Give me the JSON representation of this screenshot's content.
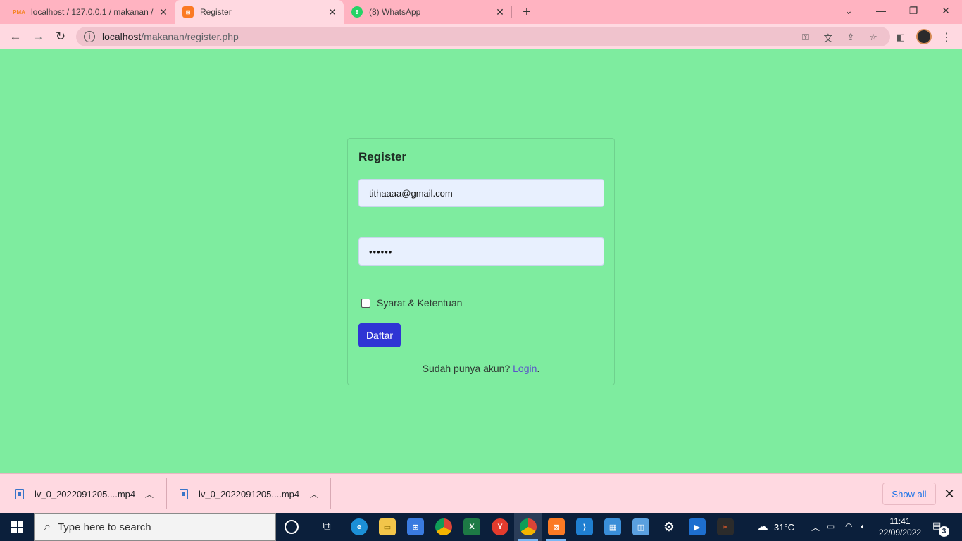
{
  "browser": {
    "tabs": [
      {
        "title": "localhost / 127.0.0.1 / makanan /",
        "icon": "phpmyadmin-icon"
      },
      {
        "title": "Register",
        "icon": "xampp-icon"
      },
      {
        "title": "(8) WhatsApp",
        "icon": "whatsapp-icon"
      }
    ],
    "url_host": "localhost",
    "url_path": "/makanan/register.php"
  },
  "form": {
    "title": "Register",
    "email_value": "tithaaaa@gmail.com",
    "password_masked": "••••••",
    "terms_label": "Syarat & Ketentuan",
    "submit_label": "Daftar",
    "login_prompt": "Sudah punya akun?",
    "login_link": "Login",
    "login_suffix": "."
  },
  "downloads": {
    "items": [
      {
        "name": "lv_0_2022091205....mp4"
      },
      {
        "name": "lv_0_2022091205....mp4"
      }
    ],
    "show_all_label": "Show all"
  },
  "taskbar": {
    "search_placeholder": "Type here to search",
    "weather": "31°C",
    "time": "11:41",
    "date": "22/09/2022",
    "notification_count": "3"
  },
  "colors": {
    "page_bg": "#7eec9f",
    "chrome_tab_strip": "#ffb3c1",
    "chrome_toolbar": "#ffd9e1",
    "button_primary": "#2f35d4",
    "link": "#5b55c9"
  }
}
